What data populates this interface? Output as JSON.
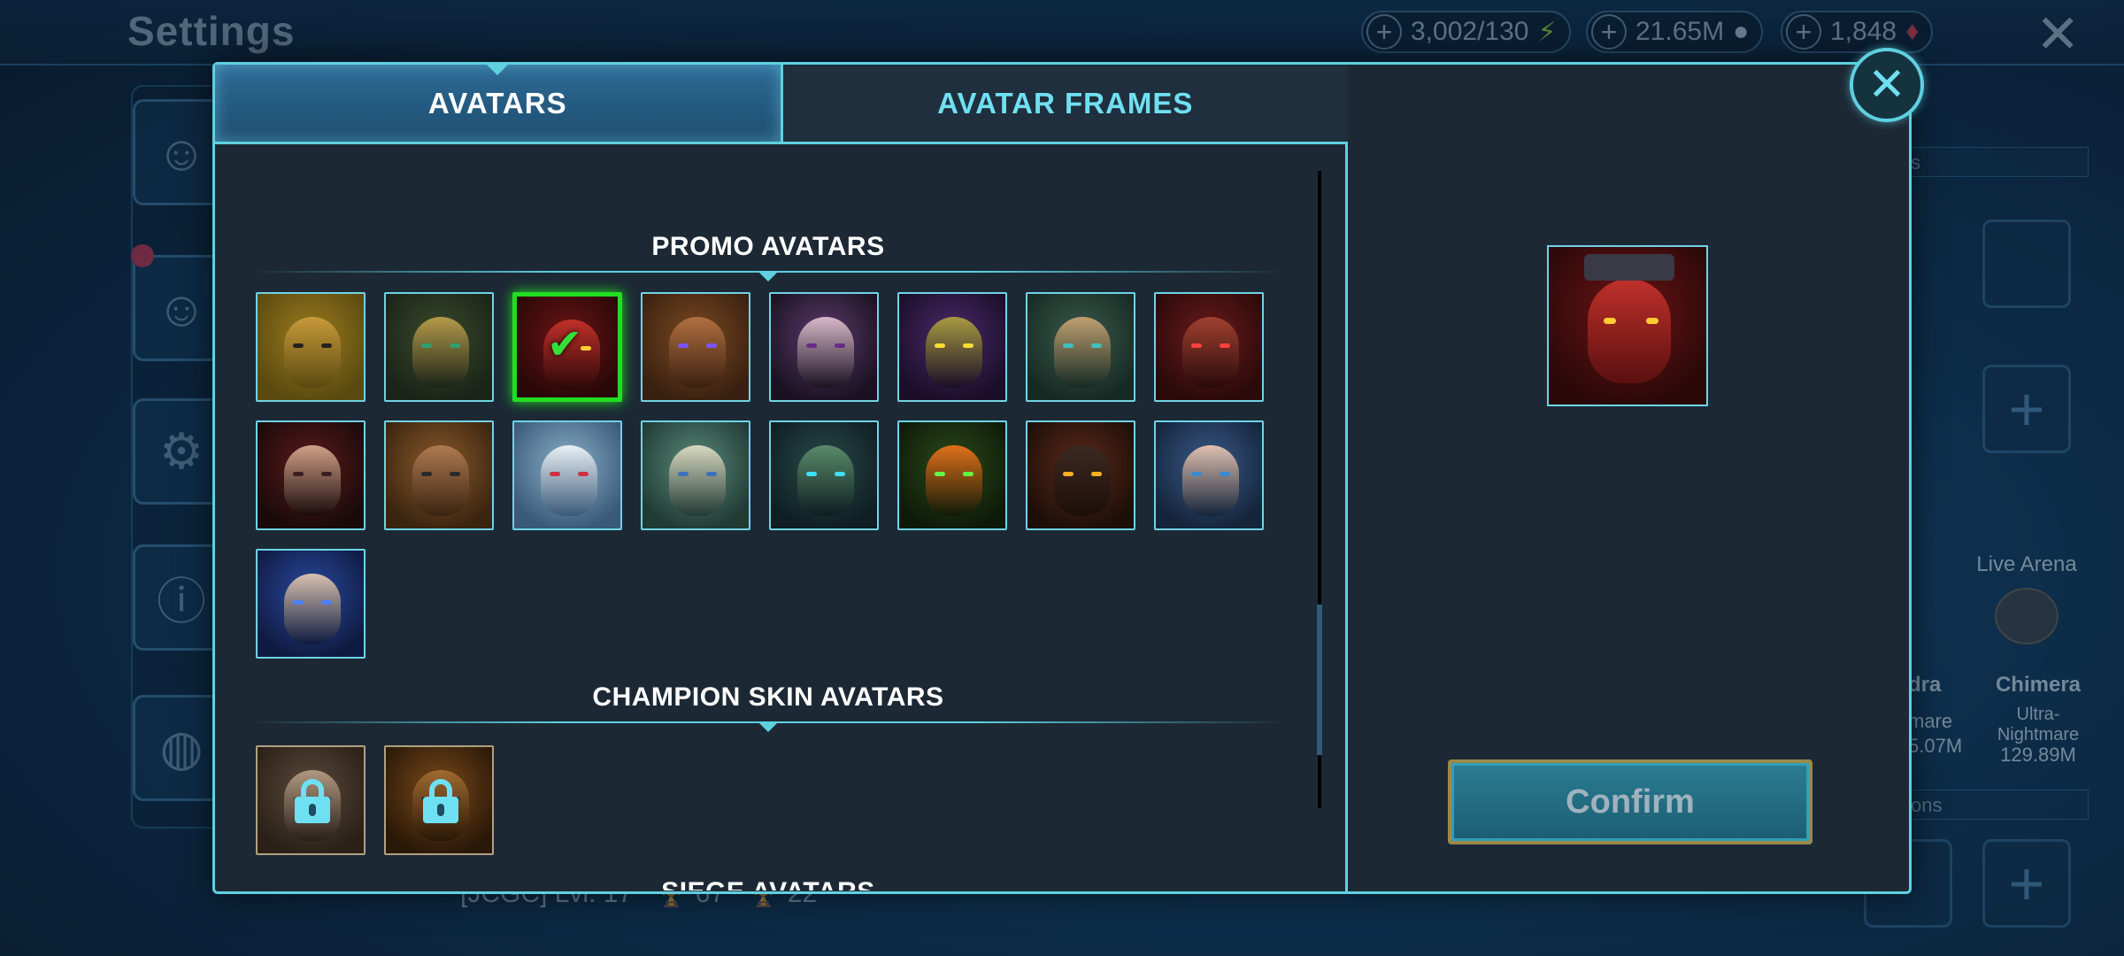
{
  "background": {
    "title": "Settings",
    "resources": [
      {
        "value": "3,002/130",
        "icon": "energy-icon"
      },
      {
        "value": "21.65M",
        "icon": "silver-icon"
      },
      {
        "value": "1,848",
        "icon": "gem-icon"
      }
    ],
    "right_panel": {
      "live_arena": "Live Arena",
      "hydra_label": "dra",
      "hydra_sub": "mare",
      "hydra_value": "5.07M",
      "chimera_label": "Chimera",
      "chimera_sub": "Ultra-Nightmare",
      "chimera_value": "129.89M",
      "strip_top": "s",
      "strip_bottom": "ons"
    },
    "clan_row": {
      "name": "[JCGC] Lvl. 17",
      "stat1": "67",
      "stat2": "22"
    }
  },
  "modal": {
    "tabs": [
      {
        "label": "AVATARS",
        "active": true
      },
      {
        "label": "AVATAR FRAMES",
        "active": false
      }
    ],
    "sections": [
      {
        "title": "PROMO AVATARS",
        "count": 17,
        "selected_index": 2
      },
      {
        "title": "CHAMPION SKIN AVATARS",
        "count": 2,
        "locked": true
      },
      {
        "title": "SIEGE AVATARS"
      }
    ],
    "confirm_label": "Confirm",
    "colors": {
      "accent": "#5fd0e0",
      "selected": "#22dd22",
      "panel": "#1c2935"
    }
  }
}
